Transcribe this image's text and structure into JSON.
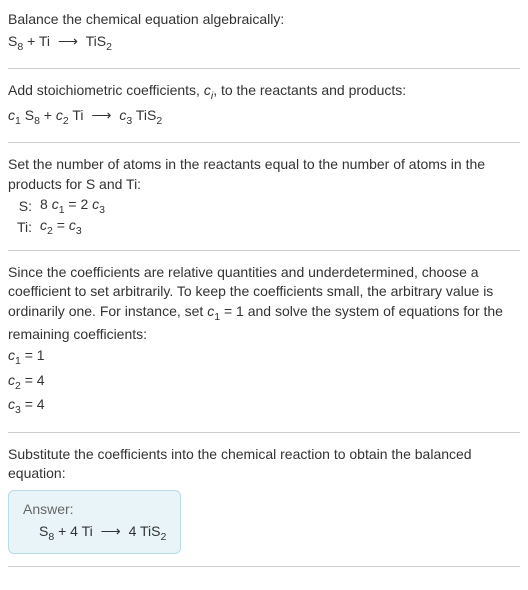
{
  "sec1": {
    "l1": "Balance the chemical equation algebraically:",
    "eq_s8": "S",
    "eq_s8_sub": "8",
    "eq_plus": " + Ti ",
    "eq_arrow": "⟶",
    "eq_tis2": " TiS",
    "eq_tis2_sub": "2"
  },
  "sec2": {
    "l1a": "Add stoichiometric coefficients, ",
    "l1b": "c",
    "l1b_sub": "i",
    "l1c": ", to the reactants and products:",
    "c1": "c",
    "c1_sub": "1",
    "s8": " S",
    "s8_sub": "8",
    "plus": " + ",
    "c2": "c",
    "c2_sub": "2",
    "ti": " Ti ",
    "arrow": "⟶",
    "c3": " c",
    "c3_sub": "3",
    "tis2": " TiS",
    "tis2_sub": "2"
  },
  "sec3": {
    "l1": "Set the number of atoms in the reactants equal to the number of atoms in the products for S and Ti:",
    "s_label": "S:",
    "s_eq_a": "8 ",
    "s_c1": "c",
    "s_c1_sub": "1",
    "s_eq_b": " = 2 ",
    "s_c3": "c",
    "s_c3_sub": "3",
    "ti_label": "Ti:",
    "ti_c2": "c",
    "ti_c2_sub": "2",
    "ti_eq": " = ",
    "ti_c3": "c",
    "ti_c3_sub": "3"
  },
  "sec4": {
    "l1a": "Since the coefficients are relative quantities and underdetermined, choose a coefficient to set arbitrarily. To keep the coefficients small, the arbitrary value is ordinarily one. For instance, set ",
    "l1b": "c",
    "l1b_sub": "1",
    "l1c": " = 1 and solve the system of equations for the remaining coefficients:",
    "c1": "c",
    "c1_sub": "1",
    "c1_val": " = 1",
    "c2": "c",
    "c2_sub": "2",
    "c2_val": " = 4",
    "c3": "c",
    "c3_sub": "3",
    "c3_val": " = 4"
  },
  "sec5": {
    "l1": "Substitute the coefficients into the chemical reaction to obtain the balanced equation:",
    "answer": "Answer:",
    "eq_s8": "S",
    "eq_s8_sub": "8",
    "eq_mid": " + 4 Ti ",
    "eq_arrow": "⟶",
    "eq_rhs": " 4 TiS",
    "eq_rhs_sub": "2"
  },
  "chart_data": {
    "type": "table",
    "title": "Balanced chemical equation coefficients",
    "reaction": "S8 + 4 Ti -> 4 TiS2",
    "coefficients": [
      {
        "symbol": "c1",
        "value": 1
      },
      {
        "symbol": "c2",
        "value": 4
      },
      {
        "symbol": "c3",
        "value": 4
      }
    ],
    "atom_balance": [
      {
        "element": "S",
        "equation": "8 c1 = 2 c3"
      },
      {
        "element": "Ti",
        "equation": "c2 = c3"
      }
    ]
  }
}
